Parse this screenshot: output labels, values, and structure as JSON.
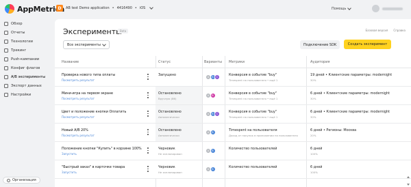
{
  "brand": {
    "name": "AppMetrica"
  },
  "app_selector": {
    "badge": "D",
    "name": "AB test Demo application",
    "id": "4416490",
    "platform": "iOS"
  },
  "header": {
    "help_label": "Помощь"
  },
  "sidebar": {
    "items": [
      {
        "label": "Обзор",
        "icon": "overview-icon"
      },
      {
        "label": "Отчеты",
        "icon": "reports-icon"
      },
      {
        "label": "Технологии",
        "icon": "technologies-icon"
      },
      {
        "label": "Трекинг",
        "icon": "tracking-icon"
      },
      {
        "label": "Push-кампании",
        "icon": "push-icon"
      },
      {
        "label": "Конфиг флагов",
        "icon": "flags-icon"
      },
      {
        "label": "A/B эксперименты",
        "icon": "ab-icon",
        "active": true
      },
      {
        "label": "Экспорт данных",
        "icon": "export-icon"
      },
      {
        "label": "Настройки",
        "icon": "settings-icon"
      }
    ],
    "org_label": "Организация"
  },
  "page": {
    "title": "Эксперименты",
    "beta": "Beta",
    "links": [
      "Базовая версия",
      "Справка"
    ],
    "filter_label": "Все эксперименты",
    "sdk_button": "Подключение SDK",
    "create_button": "Создать эксперимент"
  },
  "table": {
    "columns": [
      "Название",
      "Статус",
      "Варианты",
      "Метрики",
      "Аудитория"
    ],
    "rows": [
      {
        "name": "Проверка нового типа оплаты",
        "link": "Посмотреть результат",
        "status": "Запущено",
        "status_sub": "",
        "variants": [
          "A",
          "B",
          "C"
        ],
        "metric": "Конверсия в событие \"buy\"",
        "metric_sub": "Timespent на пользователя • ещё 1",
        "audience": "19 дней • Клиентские параметры: modernight",
        "audience_sub": "30%"
      },
      {
        "name": "Мини-игра на первом экране",
        "link": "Посмотреть результат",
        "status": "Остановлено",
        "status_sub": "Вручную (86)",
        "variants": [
          "A",
          "B"
        ],
        "metric": "Конверсия в событие \"buy\"",
        "metric_sub": "Timespent на пользователя • ещё 1",
        "audience": "6 дней • Клиентские параметры: modernight",
        "audience_sub": "30%"
      },
      {
        "name": "Цвет и положение кнопки Оплатить",
        "link": "Посмотреть результат",
        "status": "Остановлено",
        "status_sub": "Автоматически",
        "variants": [
          "A",
          "B",
          "C"
        ],
        "metric": "Конверсия в событие \"buy\"",
        "metric_sub": "Timespent на пользователя • ещё 1",
        "audience": "6 дней • Клиентские параметры: modernight",
        "audience_sub": "30%"
      },
      {
        "name": "Новый A/B 20%",
        "link": "Посмотреть результат",
        "status": "Остановлено",
        "status_sub": "Автоматически",
        "variants": [
          "A",
          "B"
        ],
        "metric": "Timespent на пользователя",
        "metric_sub": "Доход от покупок в приложении на пользователя",
        "audience": "6 дней • Регионы: Москва",
        "audience_sub": "20%"
      },
      {
        "name": "Положение кнопки \"Купить\" в корзине 100%",
        "link": "Запустить",
        "status": "Черновик",
        "status_sub": "Не запланирован",
        "variants": [
          "A",
          "B"
        ],
        "metric": "Количество пользователей",
        "metric_sub": "",
        "audience": "6 дней",
        "audience_sub": "100%"
      },
      {
        "name": "\"Быстрый заказ\" в карточке товара",
        "link": "Запустить",
        "status": "Черновик",
        "status_sub": "Не запланирован",
        "variants": [
          "A",
          "B"
        ],
        "metric": "Количество пользователей",
        "metric_sub": "",
        "audience": "6 дней",
        "audience_sub": "100%"
      }
    ]
  }
}
